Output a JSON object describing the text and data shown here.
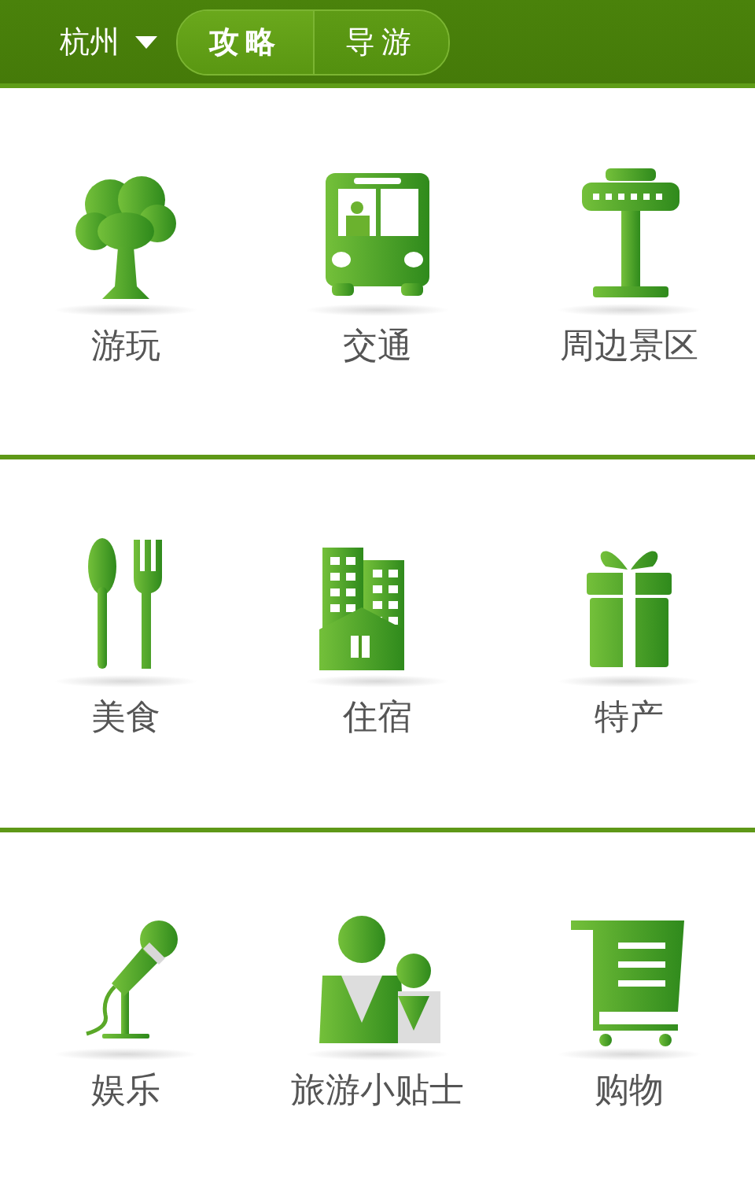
{
  "header": {
    "city": "杭州",
    "tabs": [
      {
        "label": "攻略",
        "selected": true
      },
      {
        "label": "导游",
        "selected": false
      }
    ]
  },
  "sections": [
    {
      "items": [
        {
          "label": "游玩",
          "kind": "tree"
        },
        {
          "label": "交通",
          "kind": "bus"
        },
        {
          "label": "周边景区",
          "kind": "tower"
        }
      ]
    },
    {
      "items": [
        {
          "label": "美食",
          "kind": "cutlery"
        },
        {
          "label": "住宿",
          "kind": "building"
        },
        {
          "label": "特产",
          "kind": "gift"
        }
      ]
    },
    {
      "items": [
        {
          "label": "娱乐",
          "kind": "mic"
        },
        {
          "label": "旅游小贴士",
          "kind": "people"
        },
        {
          "label": "购物",
          "kind": "cart"
        }
      ]
    }
  ]
}
